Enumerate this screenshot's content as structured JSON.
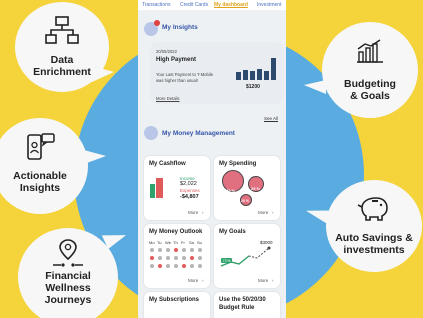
{
  "tabs": [
    "Transactions",
    "Credit Cards",
    "My dashboard",
    "Investment"
  ],
  "bubbles": {
    "data_enrichment": [
      "Data",
      "Enrichment"
    ],
    "actionable_insights": [
      "Actionable",
      "Insights"
    ],
    "financial_wellness": [
      "Financial",
      "Wellness",
      "Journeys"
    ],
    "budgeting": [
      "Budgeting",
      "& Goals"
    ],
    "auto_savings": [
      "Auto Savings &",
      "investments"
    ]
  },
  "insights": {
    "title": "My Insights",
    "date": "20/05/2022",
    "heading": "High Payment",
    "body": [
      "Your Last Payment to T-Mobile",
      "was higher than usual!"
    ],
    "more_details": "More Details",
    "amount": "$1200",
    "see_all": "See All"
  },
  "money_mgmt": {
    "title": "My Money Management"
  },
  "cashflow": {
    "title": "My Cashflow",
    "income_label": "Income",
    "income_value": "$2,022",
    "expenses_label": "Expenses",
    "expenses_value": "-$4,807",
    "more": "More"
  },
  "spending": {
    "title": "My Spending",
    "pct1": "35 %",
    "pct2": "25 %",
    "pct3": "20 %",
    "more": "More"
  },
  "outlook": {
    "title": "My Money Outlook",
    "weekdays": [
      "Mo",
      "Tu",
      "We",
      "Th",
      "Fr",
      "Sa",
      "Su"
    ],
    "more": "More"
  },
  "goals": {
    "title": "My Goals",
    "target": "$3000",
    "progress_label": "71%",
    "progress": 0.71,
    "more": "More"
  },
  "subscriptions": {
    "title": "My Subscriptions"
  },
  "rule": {
    "line1": "Use the 50/20/30",
    "line2": "Budget Rule"
  },
  "colors": {
    "yellow": "#f5d33a",
    "blue": "#5aace0",
    "accent": "#e0a21b",
    "brand": "#3557a8"
  }
}
